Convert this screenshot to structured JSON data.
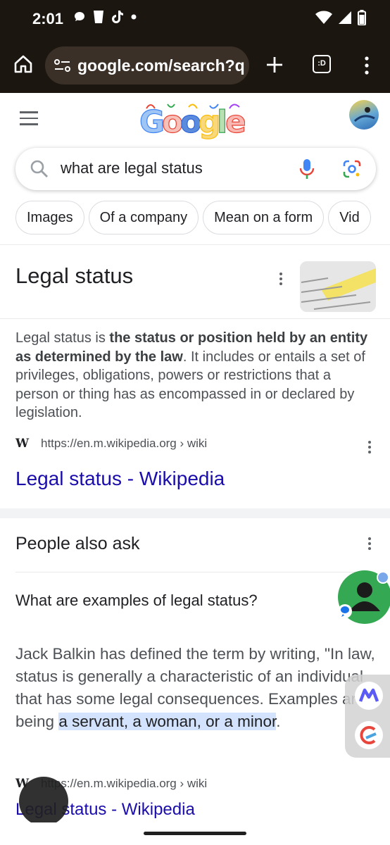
{
  "status_bar": {
    "time": "2:01"
  },
  "browser": {
    "url": "google.com/search?q",
    "tab_count": ":D"
  },
  "search": {
    "query": "what are legal status"
  },
  "chips": [
    {
      "label": "Images"
    },
    {
      "label": "Of a company"
    },
    {
      "label": "Mean on a form"
    },
    {
      "label": "Vid"
    }
  ],
  "knowledge_panel": {
    "title": "Legal status",
    "snippet_prefix": "Legal status is ",
    "snippet_bold": "the status or position held by an entity as determined by the law",
    "snippet_suffix": ". It includes or entails a set of privileges, obligations, powers or restrictions that a person or thing has as encompassed in or declared by legislation.",
    "source_logo": "W",
    "source_url": "https://en.m.wikipedia.org › wiki",
    "link_title": "Legal status - Wikipedia"
  },
  "people_also_ask": {
    "heading": "People also ask",
    "question": "What are examples of legal status?",
    "answer_prefix": "Jack Balkin has defined the term by writing, \"In law, status is generally a characteristic of an individual that has some legal consequences. Examples are being ",
    "answer_highlight": "a servant, a woman, or a minor",
    "answer_suffix": ".",
    "source_logo": "W",
    "source_url": "https://en.m.wikipedia.org › wiki",
    "link_title": "Legal status - Wikipedia"
  },
  "colors": {
    "link": "#1a0dab",
    "highlight": "#d3e3fd",
    "status_bar_bg": "#1c1610",
    "chat_bubble": "#35a853"
  }
}
